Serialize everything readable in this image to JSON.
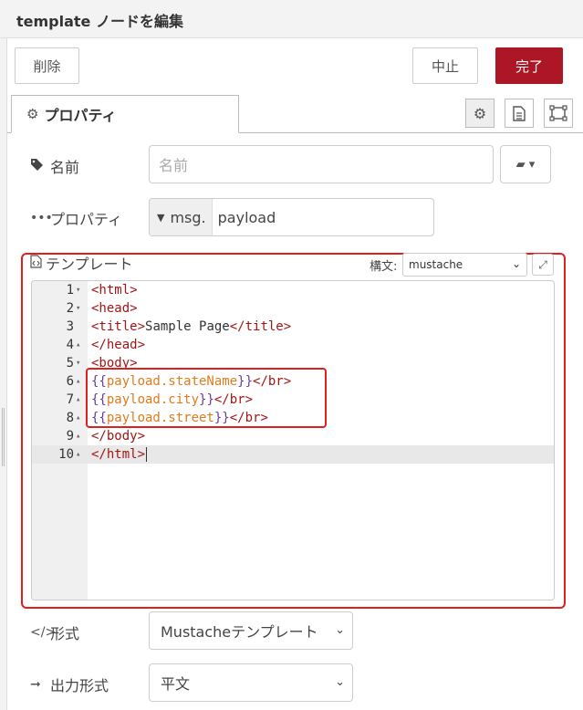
{
  "header": {
    "title": "template ノードを編集"
  },
  "toolbar": {
    "delete_label": "削除",
    "cancel_label": "中止",
    "done_label": "完了"
  },
  "tabs": {
    "properties_label": "プロパティ"
  },
  "form": {
    "name": {
      "label": "名前",
      "placeholder": "名前"
    },
    "property": {
      "label": "プロパティ",
      "type": "msg.",
      "value": "payload"
    },
    "template": {
      "label": "テンプレート",
      "syntax_label": "構文:",
      "syntax_value": "mustache",
      "lines": [
        {
          "n": "1",
          "fold": "▾"
        },
        {
          "n": "2",
          "fold": "▾"
        },
        {
          "n": "3",
          "fold": ""
        },
        {
          "n": "4",
          "fold": "▴"
        },
        {
          "n": "5",
          "fold": "▾"
        },
        {
          "n": "6",
          "fold": "▴"
        },
        {
          "n": "7",
          "fold": "▴"
        },
        {
          "n": "8",
          "fold": "▴"
        },
        {
          "n": "9",
          "fold": "▴"
        },
        {
          "n": "10",
          "fold": "▴"
        }
      ],
      "code": {
        "l1_tag": "<html>",
        "l2_tag": "<head>",
        "l3_open": "<title>",
        "l3_text": "Sample Page",
        "l3_close": "</title>",
        "l4_tag": "</head>",
        "l5_tag": "<body>",
        "l6_open": "{{",
        "l6_var": "payload.stateName",
        "l6_close": "}}",
        "l6_br": "</br>",
        "l7_open": "{{",
        "l7_var": "payload.city",
        "l7_close": "}}",
        "l7_br": "</br>",
        "l8_open": "{{",
        "l8_var": "payload.street",
        "l8_close": "}}",
        "l8_br": "</br>",
        "l9_tag": "</body>",
        "l10_tag": "</html>"
      }
    },
    "format": {
      "label": "形式",
      "value": "Mustacheテンプレート"
    },
    "output": {
      "label": "出力形式",
      "value": "平文"
    }
  },
  "colors": {
    "accent_done": "#ad1625",
    "highlight": "#e02020",
    "tag": "#a31515",
    "mustache_var": "#e07a1f"
  },
  "icons": [
    "gear-icon",
    "document-icon",
    "frame-icon",
    "tag-icon",
    "ellipsis-icon",
    "book-icon",
    "file-code-icon",
    "expand-icon",
    "code-icon",
    "arrow-right-icon"
  ]
}
